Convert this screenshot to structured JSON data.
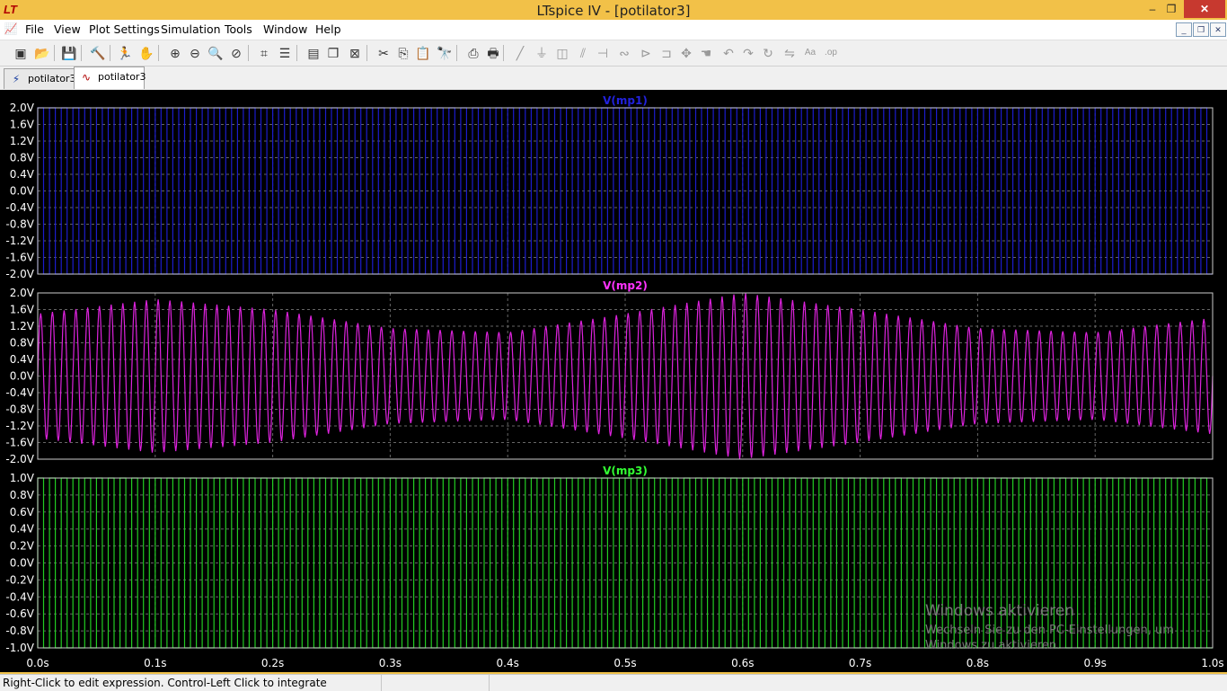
{
  "window": {
    "title": "LTspice IV - [potilator3]",
    "minimize": "‒",
    "maximize": "❐",
    "close": "✕",
    "app_icon": "LT"
  },
  "menu": {
    "items": [
      "File",
      "View",
      "Plot Settings",
      "Simulation",
      "Tools",
      "Window",
      "Help"
    ],
    "mdi": [
      "_",
      "❐",
      "✕"
    ]
  },
  "toolbar": {
    "icons": [
      "new-schematic-icon",
      "open-icon",
      "save-icon",
      "control-panel-icon",
      "run-icon",
      "halt-icon",
      "zoom-in-icon",
      "zoom-out-icon",
      "zoom-back-icon",
      "zoom-cancel-icon",
      "autorange-icon",
      "tile-horizontal-icon",
      "tile-vertical-icon",
      "cascade-icon",
      "close-window-icon",
      "cut-icon",
      "copy-icon",
      "paste-icon",
      "find-icon",
      "print-setup-icon",
      "print-icon",
      "wire-icon",
      "ground-icon",
      "label-icon",
      "resistor-icon",
      "capacitor-icon",
      "inductor-icon",
      "diode-icon",
      "component-icon",
      "move-icon",
      "drag-icon",
      "undo-icon",
      "redo-icon",
      "rotate-icon",
      "mirror-icon",
      "text-icon",
      "spice-directive-icon"
    ]
  },
  "tabs": [
    {
      "label": "potilator3",
      "type": "schematic",
      "active": false
    },
    {
      "label": "potilator3",
      "type": "waveform",
      "active": true
    }
  ],
  "chart_data": [
    {
      "type": "line",
      "title": "V(mp1)",
      "color": "#1c1ccc",
      "title_color": "#2222dd",
      "ylim": [
        -2.0,
        2.0
      ],
      "yticks": [
        "2.0V",
        "1.6V",
        "1.2V",
        "0.8V",
        "0.4V",
        "0.0V",
        "-0.4V",
        "-0.8V",
        "-1.2V",
        "-1.6V",
        "-2.0V"
      ],
      "xlim": [
        0.0,
        1.0
      ],
      "waveform": "square",
      "cycles": 100,
      "amplitude": 2.0
    },
    {
      "type": "line",
      "title": "V(mp2)",
      "color": "#dd22dd",
      "title_color": "#ff33ff",
      "ylim": [
        -2.0,
        2.0
      ],
      "yticks": [
        "2.0V",
        "1.6V",
        "1.2V",
        "0.8V",
        "0.4V",
        "0.0V",
        "-0.4V",
        "-0.8V",
        "-1.2V",
        "-1.6V",
        "-2.0V"
      ],
      "xlim": [
        0.0,
        1.0
      ],
      "waveform": "modulated-sine",
      "cycles": 100,
      "envelope": {
        "t": [
          0.0,
          0.1,
          0.2,
          0.3,
          0.4,
          0.5,
          0.6,
          0.7,
          0.8,
          0.9,
          1.0
        ],
        "amp": [
          1.5,
          1.85,
          1.6,
          1.15,
          1.05,
          1.5,
          2.0,
          1.6,
          1.15,
          1.05,
          1.4
        ]
      }
    },
    {
      "type": "line",
      "title": "V(mp3)",
      "color": "#22cc22",
      "title_color": "#33ff33",
      "ylim": [
        -1.0,
        1.0
      ],
      "yticks": [
        "1.0V",
        "0.8V",
        "0.6V",
        "0.4V",
        "0.2V",
        "0.0V",
        "-0.2V",
        "-0.4V",
        "-0.6V",
        "-0.8V",
        "-1.0V"
      ],
      "xlim": [
        0.0,
        1.0
      ],
      "waveform": "square",
      "cycles": 100,
      "amplitude": 1.0
    }
  ],
  "x_axis": {
    "ticks": [
      "0.0s",
      "0.1s",
      "0.2s",
      "0.3s",
      "0.4s",
      "0.5s",
      "0.6s",
      "0.7s",
      "0.8s",
      "0.9s",
      "1.0s"
    ]
  },
  "status": {
    "text": "Right-Click to edit expression. Control-Left Click to integrate"
  },
  "watermark": {
    "line1": "Windows aktivieren",
    "line2": "Wechseln Sie zu den PC-Einstellungen, um",
    "line3": "Windows zu aktivieren."
  }
}
